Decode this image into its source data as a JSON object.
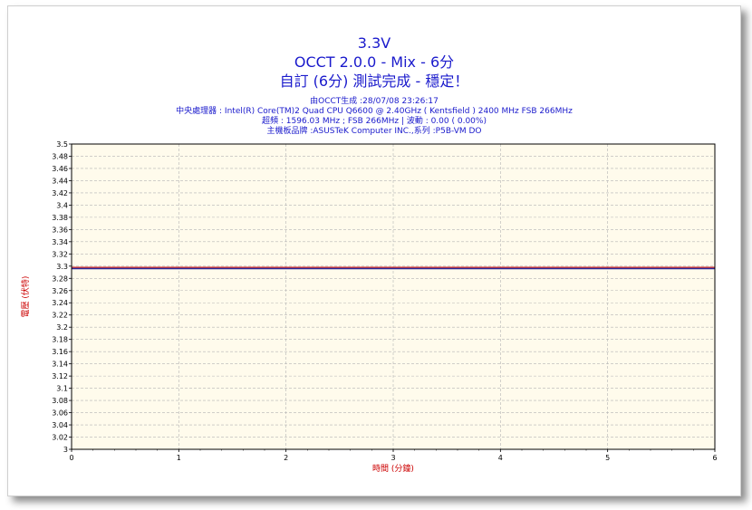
{
  "header": {
    "title_line1": "3.3V",
    "title_line2": "OCCT 2.0.0 - Mix - 6分",
    "title_line3": "自訂 (6分) 測試完成 - 穩定！",
    "info_line1": "由OCCT生成 :28/07/08 23:26:17",
    "info_line2": "中央處理器 : Intel(R) Core(TM)2 Quad CPU Q6600 @ 2.40GHz ( Kentsfield ) 2400 MHz FSB 266MHz",
    "info_line3": "超頻 : 1596.03 MHz ; FSB 266MHz | 波動 : 0.00 ( 0.00%)",
    "info_line4": "主機板品牌 :ASUSTeK Computer INC.,系列 :P5B-VM DO"
  },
  "colors": {
    "title": "#1a1acc",
    "axis_label": "#cc0000",
    "plot_bg": "#fffbec",
    "grid": "#b4b4b4",
    "series_red": "#cc2222",
    "series_blue": "#2a2a99"
  },
  "chart_data": {
    "type": "line",
    "title": "3.3V",
    "xlabel": "時間 (分鐘)",
    "ylabel": "電壓 (伏特)",
    "xlim": [
      0,
      6
    ],
    "ylim": [
      3.0,
      3.5
    ],
    "x_ticks": [
      "0",
      "1",
      "2",
      "3",
      "4",
      "5",
      "6"
    ],
    "y_ticks": [
      "3",
      "3.02",
      "3.04",
      "3.06",
      "3.08",
      "3.1",
      "3.12",
      "3.14",
      "3.16",
      "3.18",
      "3.2",
      "3.22",
      "3.24",
      "3.26",
      "3.28",
      "3.3",
      "3.32",
      "3.34",
      "3.36",
      "3.38",
      "3.4",
      "3.42",
      "3.44",
      "3.46",
      "3.48",
      "3.5"
    ],
    "grid": true,
    "series": [
      {
        "values": [
          [
            0,
            3.298
          ],
          [
            6,
            3.298
          ]
        ],
        "color": "#cc2222"
      },
      {
        "values": [
          [
            0,
            3.296
          ],
          [
            6,
            3.296
          ]
        ],
        "color": "#2a2a99"
      }
    ]
  }
}
